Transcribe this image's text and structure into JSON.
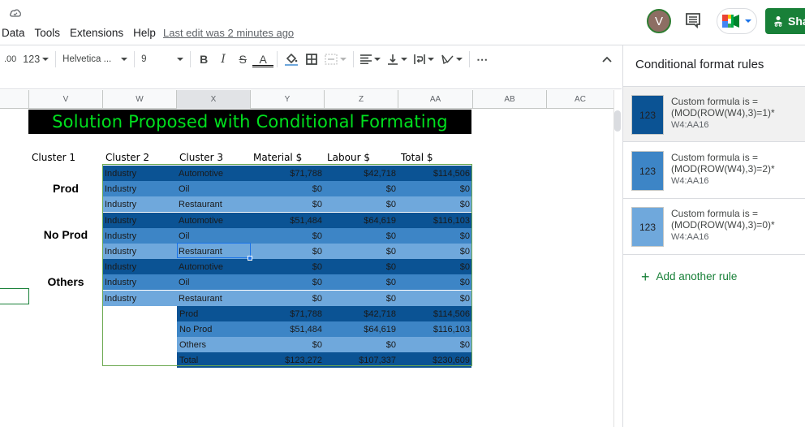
{
  "menu": {
    "items": [
      "Data",
      "Tools",
      "Extensions",
      "Help"
    ],
    "last_edit": "Last edit was 2 minutes ago"
  },
  "header": {
    "avatar_initial": "V",
    "share_label": "Sha"
  },
  "toolbar": {
    "decimal_label": ".00",
    "number_format_label": "123",
    "font_name": "Helvetica ...",
    "font_size": "9",
    "bold_label": "B",
    "italic_label": "I",
    "strike_label": "S",
    "text_color_label": "A",
    "more_label": "⋯",
    "collapse_label": "^"
  },
  "grid": {
    "columns": [
      "V",
      "W",
      "X",
      "Y",
      "Z",
      "AA",
      "AB",
      "AC"
    ],
    "selected_column": "X",
    "banner_title": "Solution Proposed with Conditional Formating",
    "headers": [
      "Cluster 1",
      "Cluster 2",
      "Cluster 3",
      "Material $",
      "Labour $",
      "Total $"
    ],
    "cluster_labels": [
      "Prod",
      "No Prod",
      "Others"
    ],
    "rows": [
      {
        "c2": "Industry",
        "c3": "Automotive",
        "material": "$71,788",
        "labour": "$42,718",
        "total": "$114,506",
        "shade": "dark"
      },
      {
        "c2": "Industry",
        "c3": "Oil",
        "material": "$0",
        "labour": "$0",
        "total": "$0",
        "shade": "mid"
      },
      {
        "c2": "Industry",
        "c3": "Restaurant",
        "material": "$0",
        "labour": "$0",
        "total": "$0",
        "shade": "light"
      },
      {
        "c2": "Industry",
        "c3": "Automotive",
        "material": "$51,484",
        "labour": "$64,619",
        "total": "$116,103",
        "shade": "dark"
      },
      {
        "c2": "Industry",
        "c3": "Oil",
        "material": "$0",
        "labour": "$0",
        "total": "$0",
        "shade": "mid"
      },
      {
        "c2": "Industry",
        "c3": "Restaurant",
        "material": "$0",
        "labour": "$0",
        "total": "$0",
        "shade": "light"
      },
      {
        "c2": "Industry",
        "c3": "Automotive",
        "material": "$0",
        "labour": "$0",
        "total": "$0",
        "shade": "dark"
      },
      {
        "c2": "Industry",
        "c3": "Oil",
        "material": "$0",
        "labour": "$0",
        "total": "$0",
        "shade": "mid"
      },
      {
        "c2": "Industry",
        "c3": "Restaurant",
        "material": "$0",
        "labour": "$0",
        "total": "$0",
        "shade": "light"
      }
    ],
    "summary_rows": [
      {
        "label": "Prod",
        "material": "$71,788",
        "labour": "$42,718",
        "total": "$114,506",
        "shade": "dark"
      },
      {
        "label": "No Prod",
        "material": "$51,484",
        "labour": "$64,619",
        "total": "$116,103",
        "shade": "mid"
      },
      {
        "label": "Others",
        "material": "$0",
        "labour": "$0",
        "total": "$0",
        "shade": "light"
      },
      {
        "label": "Total",
        "material": "$123,272",
        "labour": "$107,337",
        "total": "$230,609",
        "shade": "dark"
      }
    ]
  },
  "colors": {
    "dark": "#0b5394",
    "mid": "#3d85c6",
    "light": "#6fa8dc",
    "banner_text": "#00e01e",
    "accent_green": "#188038"
  },
  "panel": {
    "title": "Conditional format rules",
    "rules": [
      {
        "preview": "123",
        "line1": "Custom formula is =",
        "line2": "(MOD(ROW(W4),3)=1)*",
        "range": "W4:AA16",
        "color": "#0b5394"
      },
      {
        "preview": "123",
        "line1": "Custom formula is =",
        "line2": "(MOD(ROW(W4),3)=2)*",
        "range": "W4:AA16",
        "color": "#3d85c6"
      },
      {
        "preview": "123",
        "line1": "Custom formula is =",
        "line2": "(MOD(ROW(W4),3)=0)*",
        "range": "W4:AA16",
        "color": "#6fa8dc"
      }
    ],
    "add_rule_label": "Add another rule"
  }
}
